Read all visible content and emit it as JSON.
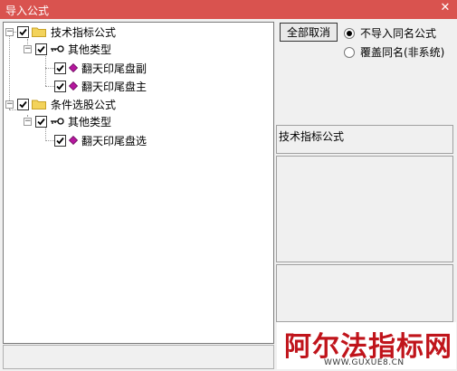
{
  "window": {
    "title": "导入公式",
    "close_glyph": "✕"
  },
  "tree": {
    "nodes": [
      {
        "label": "技术指标公式",
        "checked": true,
        "icon": "folder-icon"
      },
      {
        "label": "其他类型",
        "checked": true,
        "icon": "key-icon"
      },
      {
        "label": "翻天印尾盘副",
        "checked": true,
        "icon": "formula-diamond-icon"
      },
      {
        "label": "翻天印尾盘主",
        "checked": true,
        "icon": "formula-diamond-icon"
      },
      {
        "label": "条件选股公式",
        "checked": true,
        "icon": "folder-icon"
      },
      {
        "label": "其他类型",
        "checked": true,
        "icon": "key-icon"
      },
      {
        "label": "翻天印尾盘选",
        "checked": true,
        "icon": "formula-diamond-icon"
      }
    ]
  },
  "actions": {
    "cancel_all": "全部取消"
  },
  "options": {
    "no_import_same": "不导入同名公式",
    "overwrite_same": "覆盖同名(非系统)",
    "selected": "no_import_same"
  },
  "detail": {
    "title": "技术指标公式"
  },
  "watermark": {
    "brand": "阿尔法指标网",
    "url": "WWW.GUXUE8.CN"
  },
  "colors": {
    "titlebar": "#d9534f",
    "watermark_red": "#c0141b",
    "diamond": "#b5179e"
  }
}
